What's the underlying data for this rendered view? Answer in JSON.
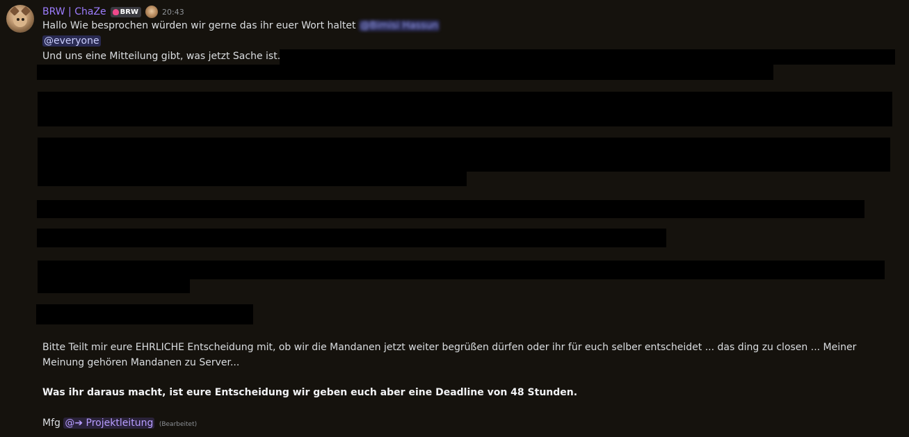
{
  "message": {
    "author": "BRW | ChaZe",
    "tag": "BRW",
    "timestamp": "20:43",
    "line1_text": "Hallo Wie besprochen würden wir gerne das ihr euer Wort haltet ",
    "line1_mention": "@Bimisi Hassun",
    "everyone_mention": "@everyone",
    "line3_text": "Und uns eine Mitteilung gibt, was jetzt Sache ist....",
    "paragraph": "Bitte Teilt mir eure EHRLICHE Entscheidung mit, ob wir die Mandanen jetzt weiter begrüßen dürfen oder ihr für euch selber entscheidet ... das ding zu closen ... Meiner Meinung gehören Mandanen zu Server...",
    "deadline": "Was ihr daraus macht, ist eure Entscheidung wir geben euch aber eine Deadline  von 48 Stunden.",
    "signoff": "Mfg ",
    "role_mention": "@➔ Projektleitung",
    "edited": "(Bearbeitet)"
  },
  "colors": {
    "background": "#15120d",
    "username": "#9d7dff",
    "mention_bg": "rgba(88,101,242,0.3)",
    "redaction": "#000000"
  },
  "icons": [
    "avatar",
    "tag-icon",
    "role-icon"
  ]
}
